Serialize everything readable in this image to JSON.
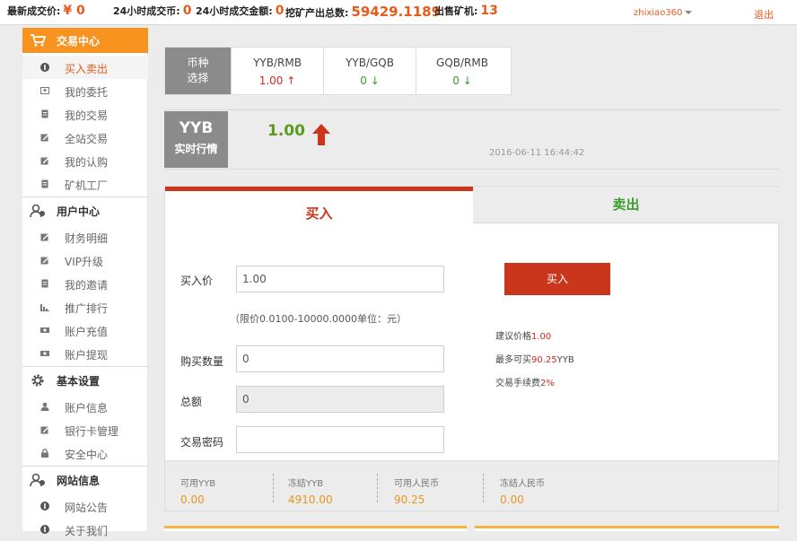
{
  "topbar": {
    "latest_price_label": "最新成交价:",
    "latest_price_value": "¥ 0",
    "coins_24h_label": "24小时成交币:",
    "coins_24h_value": "0",
    "amount_24h_label": "24小时成交金额:",
    "amount_24h_value": "0",
    "mined_total_label": "挖矿产出总数:",
    "mined_total_value": "59429.1189",
    "machines_sold_label": "出售矿机:",
    "machines_sold_value": "13",
    "username": "zhixiao360",
    "logout": "退出"
  },
  "sidebar": {
    "sections": [
      {
        "title": "交易中心",
        "icon": "cart-icon",
        "items": [
          {
            "label": "买入卖出",
            "icon": "circle-info-icon"
          },
          {
            "label": "我的委托",
            "icon": "user-card-icon"
          },
          {
            "label": "我的交易",
            "icon": "document-icon"
          },
          {
            "label": "全站交易",
            "icon": "edit-icon"
          },
          {
            "label": "我的认购",
            "icon": "edit-icon"
          },
          {
            "label": "矿机工厂",
            "icon": "document-icon"
          }
        ]
      },
      {
        "title": "用户中心",
        "icon": "users-icon",
        "items": [
          {
            "label": "财务明细",
            "icon": "edit-icon"
          },
          {
            "label": "VIP升级",
            "icon": "edit-icon"
          },
          {
            "label": "我的邀请",
            "icon": "document-icon"
          },
          {
            "label": "推广排行",
            "icon": "bar-chart-icon"
          },
          {
            "label": "账户充值",
            "icon": "money-icon"
          },
          {
            "label": "账户提现",
            "icon": "money-icon"
          }
        ]
      },
      {
        "title": "基本设置",
        "icon": "gear-icon",
        "items": [
          {
            "label": "账户信息",
            "icon": "user-icon"
          },
          {
            "label": "银行卡管理",
            "icon": "edit-icon"
          },
          {
            "label": "安全中心",
            "icon": "lock-icon"
          }
        ]
      },
      {
        "title": "网站信息",
        "icon": "users-icon",
        "items": [
          {
            "label": "网站公告",
            "icon": "circle-info-icon"
          },
          {
            "label": "关于我们",
            "icon": "circle-info-icon"
          }
        ]
      }
    ]
  },
  "currency": {
    "label": "币种选择",
    "tabs": [
      {
        "name": "YYB/RMB",
        "value": "1.00",
        "trend": "up"
      },
      {
        "name": "YYB/GQB",
        "value": "0",
        "trend": "down"
      },
      {
        "name": "GQB/RMB",
        "value": "0",
        "trend": "down"
      }
    ]
  },
  "quote": {
    "coin": "YYB",
    "subtitle": "实时行情",
    "price": "1.00",
    "timestamp": "2016-06-11 16:44:42"
  },
  "trade": {
    "buy_tab": "买入",
    "sell_tab": "卖出",
    "price_label": "买入价",
    "price_value": "1.00",
    "price_hint": "（限价0.0100-10000.0000单位：元）",
    "qty_label": "购买数量",
    "qty_value": "0",
    "total_label": "总额",
    "total_value": "0",
    "password_label": "交易密码",
    "password_value": "",
    "buy_button": "买入",
    "suggest_prefix": "建议价格",
    "suggest_value": "1.00",
    "max_prefix": "最多可买",
    "max_value": "90.25",
    "max_suffix": "YYB",
    "fee_prefix": "交易手续费",
    "fee_value": "2%"
  },
  "balances": [
    {
      "label": "可用YYB",
      "value": "0.00"
    },
    {
      "label": "冻结YYB",
      "value": "4910.00"
    },
    {
      "label": "可用人民币",
      "value": "90.25"
    },
    {
      "label": "冻结人民币",
      "value": "0.00"
    }
  ],
  "colors": {
    "accent_orange": "#f7931e",
    "buy_red": "#c9361c",
    "sell_green": "#3a9d2e",
    "balance_orange": "#e8961e"
  }
}
